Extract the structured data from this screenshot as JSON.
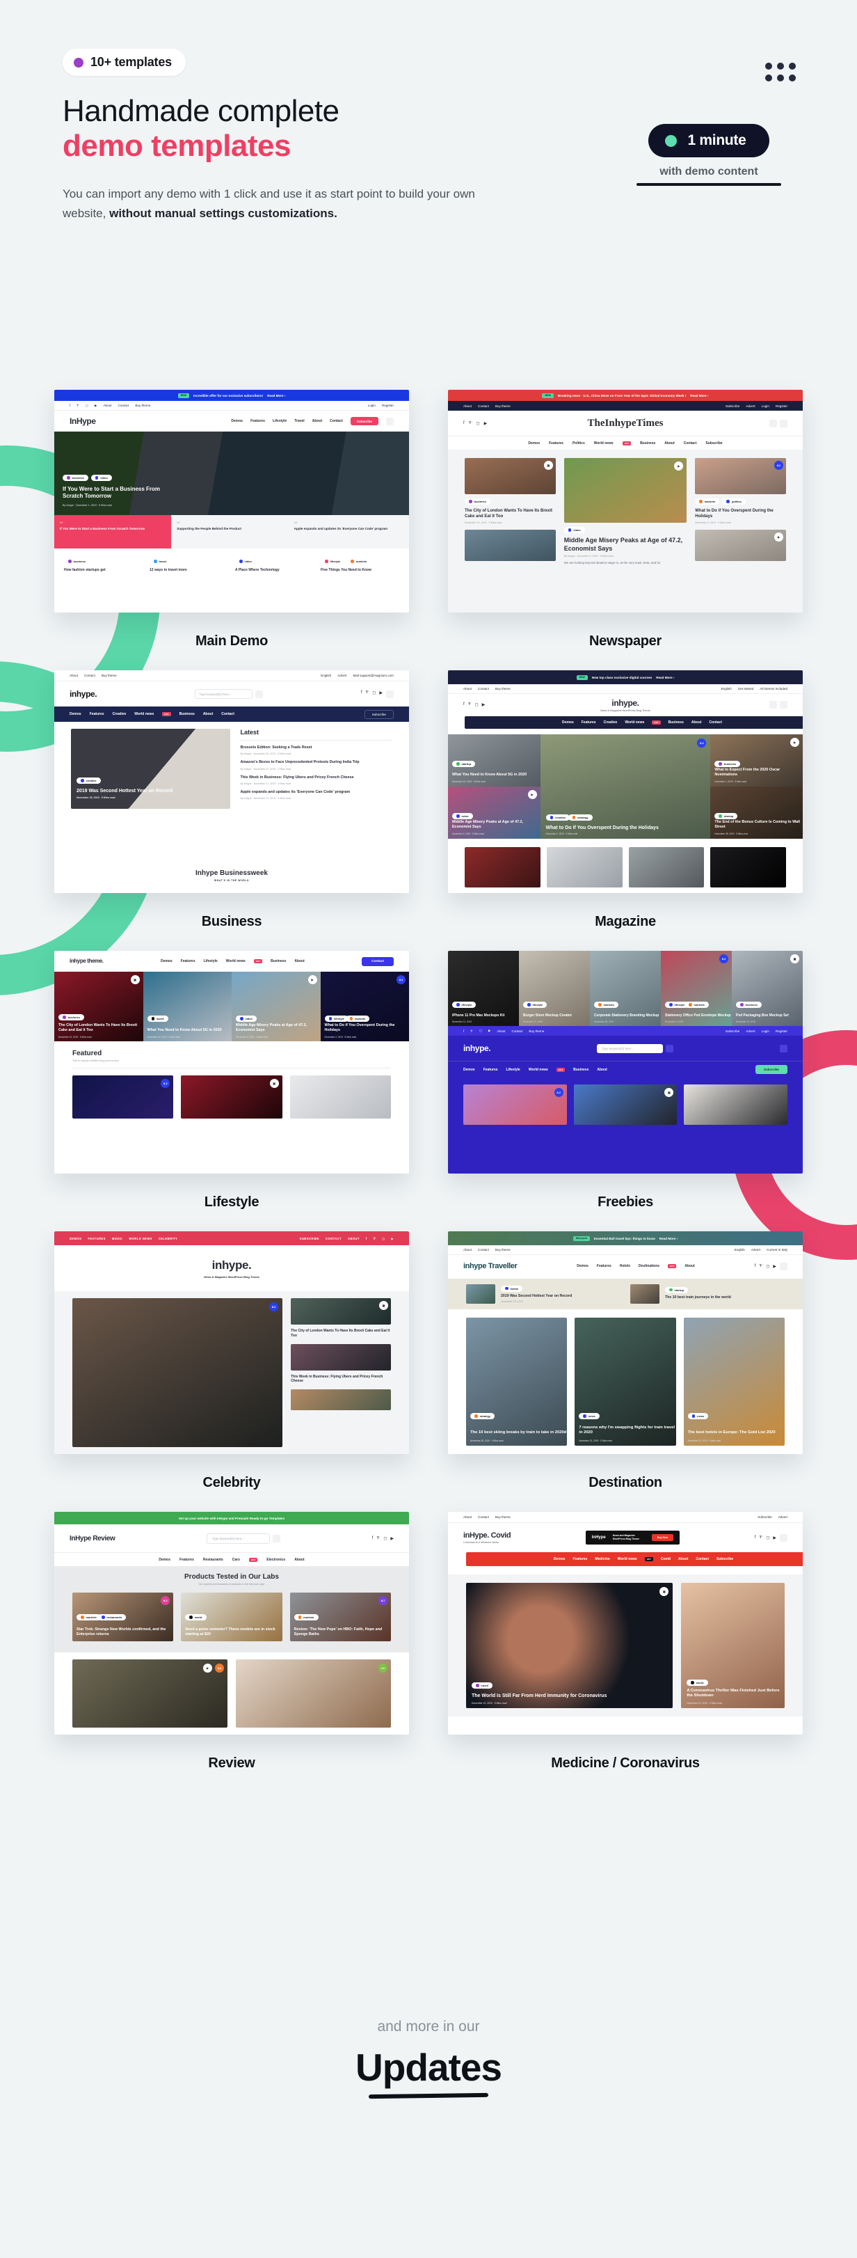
{
  "header": {
    "badge": {
      "label": "10+ templates",
      "dot_color": "#9b3fc4"
    },
    "title_line1": "Handmade complete",
    "title_line2": "demo templates",
    "title_accent_color": "#ef3f63",
    "subtitle_normal": "You can import any demo with 1 click and use it as start point to build your own website, ",
    "subtitle_bold": "without manual settings customizations.",
    "grid_icon": "grid-dots-icon",
    "minute_badge": {
      "label": "1 minute",
      "dot_color": "#5fdcb0",
      "background": "#101327"
    },
    "minute_caption": "with demo content"
  },
  "templates": [
    {
      "label": "Main Demo",
      "notice": {
        "tag": "NEW",
        "text": "Incredible offer for our exclusive subscribers!",
        "cta": "Read More ›",
        "bg": "#1939e0"
      },
      "util_left": [
        "About",
        "Contact",
        "Buy theme"
      ],
      "util_right": [
        "Login",
        "Register"
      ],
      "brand": "InHype",
      "menu": [
        "Demos",
        "Features",
        "Lifestyle",
        "Travel",
        "About",
        "Contact"
      ],
      "cta_button": "Subscribe",
      "hero_tags": [
        "business",
        "video"
      ],
      "hero_title": "If You Were to Start a Business From Scratch Tomorrow",
      "hero_meta": "By Inhype · December 1, 2019 · 5 Mins read",
      "numbered": [
        {
          "num": "01",
          "title": "If You Were to Start a Business From Scratch Tomorrow"
        },
        {
          "num": "02",
          "title": "Supporting the People Behind the Product"
        },
        {
          "num": "03",
          "title": "Apple expands and updates its 'Everyone Can Code' program"
        }
      ],
      "bottom_items": [
        {
          "tag": "business",
          "title": "How fashion startups get"
        },
        {
          "tag": "travel",
          "title": "12 ways to travel more"
        },
        {
          "tag": "video",
          "title": "A Place Where Technology"
        },
        {
          "tag": "lifestyle",
          "tag2": "markets",
          "title": "Five Things You Need to Know"
        }
      ]
    },
    {
      "label": "Newspaper",
      "notice": {
        "tag": "NEW",
        "text": "Breaking news · U.S., China Move on From Year of the Spat: Global Economy Week !",
        "cta": "Read More ›",
        "bg": "#e03c3c"
      },
      "util_left": [
        "About",
        "Contact",
        "Buy theme"
      ],
      "util_right": [
        "Subscribe",
        "Advert",
        "Login",
        "Register"
      ],
      "brand": "TheInhypeTimes",
      "menu": [
        "Demos",
        "Features",
        "Politics",
        "World news",
        "Business",
        "About",
        "Contact",
        "Subscribe"
      ],
      "posts": [
        {
          "tag": "business",
          "title": "The City of London Wants To Have Its Brexit Cake and Eat It Too",
          "meta": "December 10, 2019 · 5 Mins read"
        },
        {
          "tag": "video",
          "title": "Middle Age Misery Peaks at Age of 47.2, Economist Says",
          "meta": "By Inhype · December 3, 2019 · 5 Mins read",
          "excerpt": "We are looking beyond ideation stage to, at the very least, beta, and for"
        },
        {
          "tag": "markets",
          "tag2": "politics",
          "title": "What to Do if You Overspent During the Holidays",
          "meta": "December 2, 2019 · 5 Mins read"
        }
      ]
    },
    {
      "label": "Business",
      "util_left": [
        "About",
        "Contact",
        "Buy theme"
      ],
      "util_right": [
        "English",
        "Advert",
        "Mail support@magnium.com"
      ],
      "brand": "inhype.",
      "search_placeholder": "Type keyword(s) here...",
      "menu": [
        "Demos",
        "Features",
        "Creative",
        "World news",
        "Business",
        "About",
        "Contact"
      ],
      "cta_button": "Subscribe",
      "hero_tag": "creative",
      "hero_title": "2019 Was Second Hottest Year on Record",
      "hero_meta": "November 25, 2019 · 5 Mins read",
      "sidebar_heading": "Latest",
      "latest": [
        {
          "title": "Brussels Edition: Seeking a Trade Reset",
          "meta": "By Inhype · November 25, 2019 · 5 Mins read"
        },
        {
          "title": "Amazon's Bezos to Face Unprecedented Protests During India Trip",
          "meta": "By Inhype · November 21, 2019 · 4 Mins read"
        },
        {
          "title": "This Week in Business: Flying Ubers and Pricey French Cheese",
          "meta": "By Inhype · November 21, 2019 · 5 Mins read"
        },
        {
          "title": "Apple expands and updates its 'Everyone Can Code' program",
          "meta": "By Inhype · November 21, 2019 · 4 Mins read"
        }
      ],
      "section_title": "Inhype Businessweek",
      "section_sub": "WHAT'S IN THE WORLD"
    },
    {
      "label": "Magazine",
      "notice": {
        "tag": "NEW",
        "text": "New top class exclusive digital courses",
        "cta": "Read More ›",
        "bg": "#1a1f3d"
      },
      "util_left": [
        "About",
        "Contact",
        "Buy theme"
      ],
      "util_right": [
        "English",
        "Get started",
        "All Demos Included"
      ],
      "brand": "inhype.",
      "tagline": "News & Magazine WordPress Blog Theme",
      "menu": [
        "Demos",
        "Features",
        "Creative",
        "World news",
        "Business",
        "About",
        "Contact"
      ],
      "tiles": [
        {
          "tag": "startup",
          "title": "What You Need to Know About 5G in 2020",
          "meta": "December 10, 2019 · 5 Mins read"
        },
        {
          "tag": "news",
          "title": "Middle Age Misery Peaks at Age of 47.2, Economist Says",
          "meta": "December 3, 2019 · 5 Mins read"
        },
        {
          "tag": "creative",
          "tag2": "strategy",
          "title": "What to Do if You Overspent During the Holidays",
          "meta": "December 2, 2019 · 5 Mins read"
        },
        {
          "tag": "business",
          "tag2": "news",
          "title": "What to Expect From the 2020 Oscar Nominations",
          "meta": "December 1, 2019 · 5 Mins read"
        },
        {
          "tag": "startup",
          "title": "The End of the Bonus Culture Is Coming to Wall Street",
          "meta": "November 28, 2019 · 5 Mins read"
        }
      ]
    },
    {
      "label": "Lifestyle",
      "brand": "inhype theme.",
      "menu": [
        "Demos",
        "Features",
        "Lifestyle",
        "World news",
        "Business",
        "About"
      ],
      "cta_button": "Contact",
      "tiles": [
        {
          "tag": "business",
          "title": "The City of London Wants To Have Its Brexit Cake and Eat It Too",
          "meta": "December 10, 2019 · 5 Mins read"
        },
        {
          "tag": "world",
          "title": "What You Need to Know About 5G in 2020",
          "meta": "December 10, 2019 · 5 Mins read"
        },
        {
          "tag": "video",
          "title": "Middle Age Misery Peaks at Age of 47.2, Economist Says",
          "meta": "December 3, 2019 · 5 Mins read"
        },
        {
          "tag": "lifestyle",
          "tag2": "markets",
          "title": "What to Do if You Overspent During the Holidays",
          "meta": "December 2, 2019 · 5 Mins read"
        }
      ],
      "section_title": "Featured",
      "section_sub": "This is sample subtitle blog post section"
    },
    {
      "label": "Freebies",
      "tiles": [
        {
          "tag": "lifestyle",
          "title": "iPhone 11 Pro Max Mockups Kit",
          "meta": "November 21, 2019"
        },
        {
          "tag": "lifestyle",
          "title": "Burger Store Mockup Creator",
          "meta": "November 21, 2019"
        },
        {
          "tag": "markets",
          "title": "Corporate Stationery Branding Mockup",
          "meta": "November 28, 2019"
        },
        {
          "tag": "lifestyle",
          "tag2": "markets",
          "title": "Stationery Office Psd Envelope Mockup",
          "meta": "December 2, 2019"
        },
        {
          "tag": "business",
          "title": "Psd Packaging Box Mockup Set",
          "meta": "December 10, 2019"
        }
      ],
      "util_left": [
        "About",
        "Contact",
        "Buy theme"
      ],
      "util_right": [
        "Subscribe",
        "Advert",
        "Login",
        "Register"
      ],
      "brand": "inhype.",
      "search_placeholder": "Type keyword(s) here...",
      "menu": [
        "Demos",
        "Features",
        "Lifestyle",
        "World news",
        "Business",
        "About"
      ],
      "cta_button": "Subscribe"
    },
    {
      "label": "Celebrity",
      "menu": [
        "DEMOS",
        "FEATURES",
        "MUSIC",
        "WORLD NEWS",
        "CELEBRITY"
      ],
      "util_right": [
        "SUBSCRIBE",
        "CONTACT",
        "ABOUT"
      ],
      "brand": "inhype.",
      "tagline": "News & Magazine WordPress Blog Theme",
      "side_posts": [
        {
          "title": "The City of London Wants To Have Its Brexit Cake and Eat It Too"
        },
        {
          "title": "This Week in Business: Flying Ubers and Pricey French Cheese"
        }
      ]
    },
    {
      "label": "Destination",
      "notice": {
        "tag": "New post",
        "text": "Essential Bali travel tips: things to know",
        "cta": "Read More ›",
        "bg": "#4f7a62"
      },
      "util_left": [
        "About",
        "Contact",
        "Buy theme"
      ],
      "util_right": [
        "English",
        "Advert",
        "Current in Italy"
      ],
      "brand": "inhype Traveller",
      "menu": [
        "Demos",
        "Features",
        "Hotels",
        "Destinations",
        "About"
      ],
      "strip": [
        {
          "tag": "hotels",
          "title": "2019 Was Second Hottest Year on Record",
          "meta": "November 25, 2019"
        },
        {
          "tag": "startup",
          "title": "The 10 best train journeys in the world",
          "meta": "November 25, 2019"
        }
      ],
      "tiles": [
        {
          "tag": "strategy",
          "title": "The 10 best skiing breaks by train to take in 2020d",
          "meta": "November 25, 2019 · 4 Mins read"
        },
        {
          "tag": "news",
          "title": "7 reasons why I'm swapping flights for train travel in 2020",
          "meta": "November 21, 2019 · 5 Mins read"
        },
        {
          "tag": "news",
          "title": "The best hotels in Europe: The Gold List 2020",
          "meta": "November 21, 2019 · 4 Mins read"
        }
      ]
    },
    {
      "label": "Review",
      "notice": {
        "text": "Set up your website with InHype and Premade Ready-to-go Templates",
        "bg": "#3faa52"
      },
      "brand": "InHype Review",
      "search_placeholder": "Type keyword(s) here...",
      "menu": [
        "Demos",
        "Features",
        "Restaurants",
        "Cars",
        "Electronics",
        "About"
      ],
      "section_title": "Products Tested in Our Labs",
      "section_sub": "Our experts put thousands of products to the test each year",
      "tiles": [
        {
          "tag": "markets",
          "tag2": "restaurants",
          "title": "Star Trek: Strange New Worlds confirmed, and the Enterprise returns",
          "score": "8.2"
        },
        {
          "tag": "world",
          "title": "Need a pulse oximeter? These models are in stock starting at $20"
        },
        {
          "tag": "markets",
          "title": "Review: 'The New Pope' on HBO: Faith, Hope and Sponge Baths",
          "score": "8.7"
        }
      ],
      "bottom_scores": [
        "6.6",
        "4.6"
      ]
    },
    {
      "label": "Medicine / Coronavirus",
      "util_left": [
        "About",
        "Contact",
        "Buy theme"
      ],
      "util_right": [
        "Subscribe",
        "Advert"
      ],
      "brand": "inHype. Covid",
      "tagline": "Coronavirus & Medicine News",
      "ad": {
        "brand": "InHype",
        "text": "News and Magazine WordPress Blog Theme",
        "button": "Buy Now"
      },
      "menu": [
        "Demos",
        "Features",
        "Medicine",
        "World news",
        "Covid",
        "About",
        "Contact",
        "Subscribe"
      ],
      "tiles": [
        {
          "tag": "covid",
          "title": "The World Is Still Far From Herd Immunity for Coronavirus",
          "meta": "December 10, 2019 · 5 Mins read"
        },
        {
          "tag": "world",
          "title": "A Coronavirus Thriller Was Finished Just Before the Shutdown",
          "meta": "December 10, 2019 · 5 Mins read"
        }
      ]
    }
  ],
  "footer": {
    "eyebrow": "and more in our",
    "title": "Updates"
  },
  "colors": {
    "page_bg": "#f0f4f5",
    "accent_pink": "#ef3f63",
    "accent_teal": "#5ad6a8",
    "accent_purple": "#9b3fc4",
    "ink": "#14161d"
  }
}
